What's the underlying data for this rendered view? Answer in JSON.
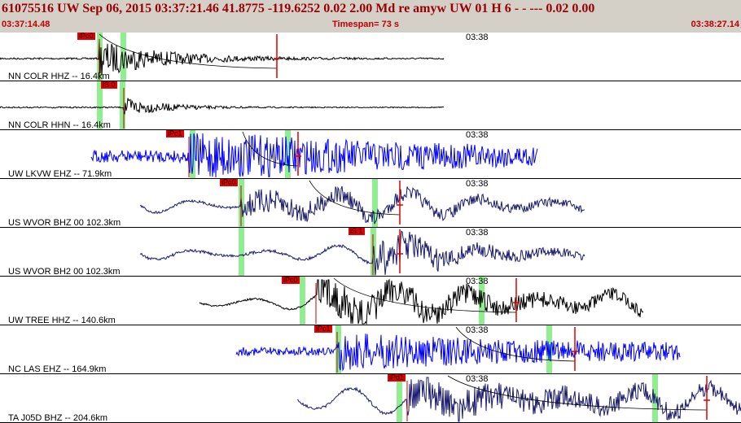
{
  "header": {
    "title": "61075516 UW Sep 06, 2015 03:37:21.46   41.8775 -119.6252  0.02 2.00 Md re    amyw    UW 01 H    6  -  - ---  0.02 0.00",
    "start_time": "03:37:14.48",
    "timespan": "Timespan= 73 s",
    "end_time": "03:38:27.14"
  },
  "colors": {
    "background": "#ffffff",
    "header_bg": "#d4d0c8",
    "title_text": "#9a0000",
    "pick_flag": "#e00000",
    "phase_window": "#90ee90",
    "trace_blue": "#0000ff",
    "trace_navy": "#1a1a6e",
    "trace_black": "#000000"
  },
  "panels": [
    {
      "station": "NN COLR HHZ -- 16.4km",
      "time_label": "03:38",
      "pick": "iPc0",
      "trace_color": "#000000"
    },
    {
      "station": "NN COLR HHN -- 16.4km",
      "time_label": "",
      "pick": "iS 0",
      "trace_color": "#000000"
    },
    {
      "station": "UW LKVW EHZ -- 71.9km",
      "time_label": "03:38",
      "pick": "iPc1",
      "trace_color": "#0000ff"
    },
    {
      "station": "US WVOR BHZ 00 102.3km",
      "time_label": "03:38",
      "pick": "iPc0",
      "trace_color": "#1a1a6e"
    },
    {
      "station": "US WVOR BH2 00 102.3km",
      "time_label": "03:38",
      "pick": "iS 1",
      "trace_color": "#1a1a6e"
    },
    {
      "station": "UW TREE HHZ -- 140.6km",
      "time_label": "03:38",
      "pick": "iPc0",
      "trace_color": "#000000"
    },
    {
      "station": "NC LAS EHZ -- 164.9km",
      "time_label": "03:38",
      "pick": "iPc1",
      "trace_color": "#0000ff"
    },
    {
      "station": "TA J05D BHZ -- 204.6km",
      "time_label": "03:38",
      "pick": "iPd1",
      "trace_color": "#1a1a6e"
    }
  ]
}
